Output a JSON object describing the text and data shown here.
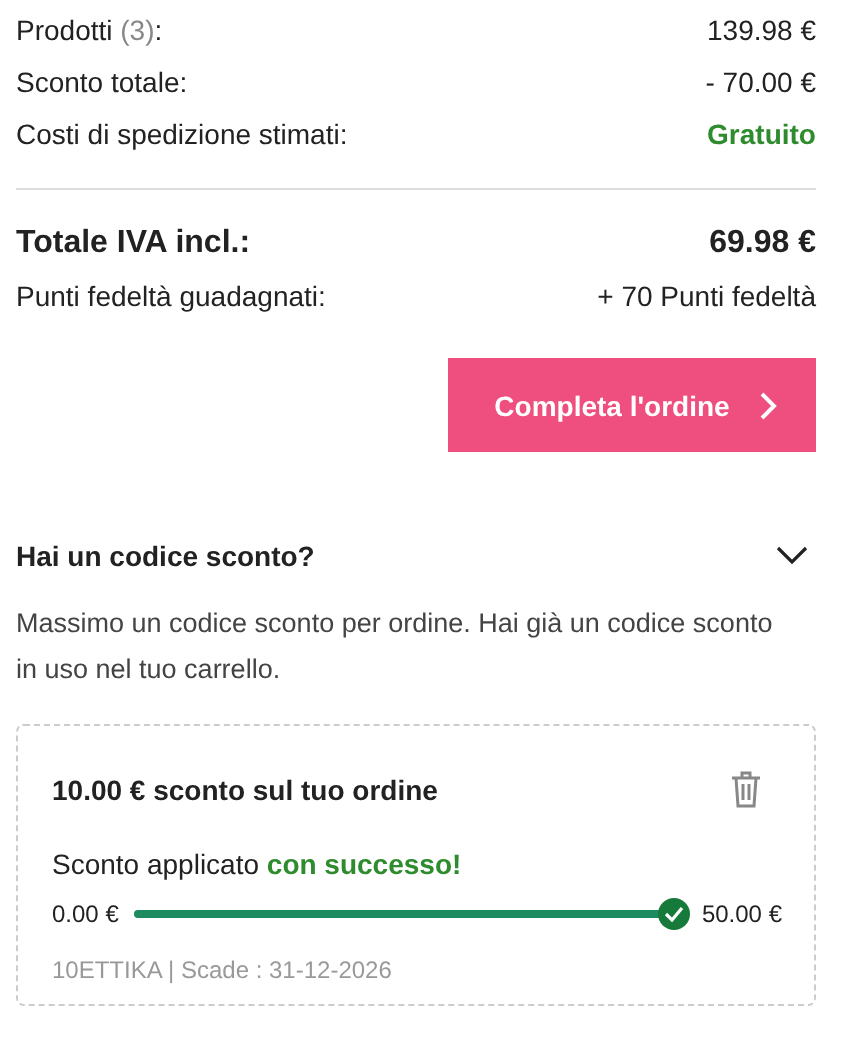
{
  "summary": {
    "rows": [
      {
        "label": "Prodotti *(3)*:",
        "value": "139.98 €",
        "kind": "plain"
      },
      {
        "label": "Sconto totale:",
        "value": "- 70.00 €",
        "kind": "plain"
      },
      {
        "label": "Costi di spedizione stimati:",
        "value": "Gratuito",
        "kind": "free"
      }
    ]
  },
  "total": {
    "label": "Totale IVA incl.:",
    "value": "69.98 €"
  },
  "points": {
    "label": "Punti fedeltà guadagnati:",
    "value": "+ 70 Punti fedeltà"
  },
  "checkout_button": "Completa l'ordine",
  "coupon": {
    "title": "Hai un codice sconto?",
    "expanded": true,
    "note": "Massimo un codice sconto per ordine. Hai già un codice sconto in uso nel tuo carrello.",
    "card": {
      "title": "10.00 € sconto sul tuo ordine",
      "status": "Sconto applicato **con successo!**",
      "min": "0.00 €",
      "max": "50.00 €",
      "level": 1,
      "code": "10ETTIKA | Scade : 31-12-2026"
    }
  }
}
